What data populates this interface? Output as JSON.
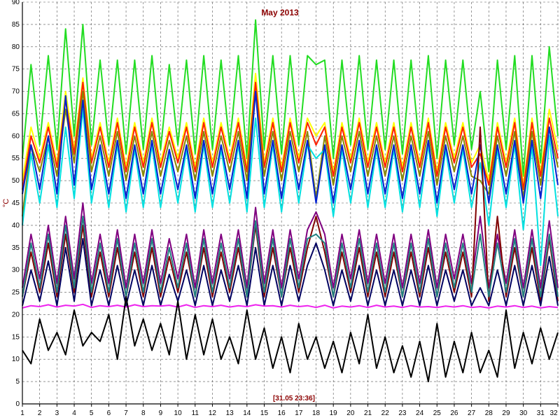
{
  "colors": {
    "background": "#ffffff",
    "grid": "#555555",
    "axis": "#000000",
    "title": "#8b0000"
  },
  "chart_data": {
    "type": "line",
    "title": "May 2013",
    "ylabel": "°C",
    "status": "[31.05 23:36]",
    "xlim": [
      1,
      32
    ],
    "ylim": [
      0,
      90
    ],
    "x_ticks": [
      "1",
      "2",
      "3",
      "4",
      "5",
      "6",
      "7",
      "8",
      "9",
      "10",
      "11",
      "12",
      "13",
      "14",
      "15",
      "16",
      "17",
      "18",
      "19",
      "20",
      "21",
      "22",
      "23",
      "24",
      "25",
      "26",
      "27",
      "28",
      "29",
      "30",
      "31",
      "32"
    ],
    "y_ticks": [
      "0",
      "5",
      "10",
      "15",
      "20",
      "25",
      "30",
      "35",
      "40",
      "45",
      "50",
      "55",
      "60",
      "65",
      "70",
      "75",
      "80",
      "85",
      "90"
    ],
    "grid": "dashed",
    "x": [
      1.0,
      1.5,
      2.0,
      2.5,
      3.0,
      3.5,
      4.0,
      4.5,
      5.0,
      5.5,
      6.0,
      6.5,
      7.0,
      7.5,
      8.0,
      8.5,
      9.0,
      9.5,
      10.0,
      10.5,
      11.0,
      11.5,
      12.0,
      12.5,
      13.0,
      13.5,
      14.0,
      14.5,
      15.0,
      15.5,
      16.0,
      16.5,
      17.0,
      17.5,
      18.0,
      18.5,
      19.0,
      19.5,
      20.0,
      20.5,
      21.0,
      21.5,
      22.0,
      22.5,
      23.0,
      23.5,
      24.0,
      24.5,
      25.0,
      25.5,
      26.0,
      26.5,
      27.0,
      27.5,
      28.0,
      28.5,
      29.0,
      29.5,
      30.0,
      30.5,
      31.0,
      31.5,
      32.0
    ],
    "series": [
      {
        "color": "#22dd22",
        "values": [
          55,
          76,
          58,
          78,
          57,
          84,
          60,
          85,
          58,
          77,
          58,
          77,
          56,
          77,
          57,
          78,
          57,
          76,
          58,
          77,
          56,
          78,
          57,
          77,
          58,
          78,
          55,
          86,
          57,
          78,
          56,
          78,
          58,
          78,
          76,
          77,
          55,
          77,
          58,
          78,
          57,
          77,
          57,
          77,
          56,
          77,
          57,
          78,
          55,
          77,
          58,
          77,
          57,
          70,
          52,
          77,
          57,
          78,
          51,
          78,
          54,
          80,
          60
        ]
      },
      {
        "color": "#ffff00",
        "values": [
          50,
          62,
          55,
          63,
          54,
          70,
          57,
          73,
          55,
          63,
          54,
          64,
          53,
          63,
          54,
          64,
          54,
          62,
          55,
          63,
          53,
          64,
          54,
          63,
          55,
          64,
          53,
          74,
          54,
          64,
          53,
          64,
          55,
          64,
          60,
          63,
          52,
          63,
          55,
          64,
          54,
          63,
          54,
          63,
          53,
          63,
          54,
          64,
          52,
          63,
          55,
          63,
          54,
          58,
          50,
          63,
          54,
          64,
          49,
          64,
          52,
          66,
          57
        ]
      },
      {
        "color": "#ff2000",
        "values": [
          48,
          60,
          54,
          62,
          53,
          68,
          56,
          72,
          54,
          62,
          53,
          63,
          52,
          62,
          53,
          63,
          53,
          61,
          54,
          62,
          52,
          63,
          53,
          62,
          54,
          63,
          52,
          72,
          53,
          63,
          52,
          63,
          54,
          63,
          58,
          62,
          51,
          62,
          54,
          63,
          53,
          62,
          53,
          62,
          52,
          62,
          53,
          63,
          51,
          62,
          54,
          62,
          53,
          56,
          49,
          62,
          53,
          63,
          48,
          63,
          51,
          64,
          55
        ]
      },
      {
        "color": "#888800",
        "values": [
          42,
          58,
          52,
          60,
          51,
          66,
          54,
          70,
          52,
          60,
          51,
          61,
          50,
          60,
          51,
          61,
          51,
          59,
          52,
          60,
          50,
          61,
          51,
          60,
          52,
          61,
          50,
          70,
          51,
          61,
          50,
          61,
          52,
          61,
          46,
          60,
          49,
          60,
          52,
          61,
          51,
          60,
          51,
          60,
          50,
          60,
          51,
          61,
          49,
          60,
          52,
          60,
          51,
          50,
          47,
          60,
          51,
          61,
          46,
          61,
          49,
          62,
          53
        ]
      },
      {
        "color": "#00e0e0",
        "values": [
          40,
          56,
          45,
          58,
          44,
          62,
          46,
          66,
          45,
          57,
          44,
          58,
          43,
          57,
          44,
          58,
          44,
          56,
          45,
          57,
          43,
          58,
          44,
          57,
          45,
          58,
          43,
          64,
          44,
          58,
          43,
          58,
          45,
          58,
          55,
          57,
          42,
          57,
          45,
          58,
          44,
          57,
          44,
          57,
          43,
          57,
          44,
          58,
          42,
          57,
          45,
          57,
          44,
          54,
          40,
          57,
          44,
          58,
          39,
          58,
          31,
          60,
          42
        ]
      },
      {
        "color": "#0020d0",
        "values": [
          47,
          58,
          48,
          60,
          47,
          69,
          49,
          68,
          48,
          58,
          47,
          59,
          46,
          58,
          47,
          59,
          47,
          57,
          48,
          58,
          46,
          59,
          47,
          58,
          48,
          59,
          46,
          70,
          47,
          59,
          46,
          59,
          48,
          59,
          45,
          58,
          45,
          58,
          48,
          59,
          47,
          58,
          47,
          58,
          46,
          58,
          47,
          59,
          45,
          58,
          48,
          58,
          47,
          58,
          45,
          58,
          47,
          59,
          45,
          59,
          46,
          62,
          49
        ]
      },
      {
        "color": "#800080",
        "values": [
          26,
          38,
          28,
          40,
          27,
          42,
          28,
          45,
          27,
          38,
          27,
          39,
          26,
          38,
          27,
          39,
          27,
          37,
          28,
          38,
          26,
          39,
          27,
          38,
          28,
          39,
          26,
          44,
          27,
          39,
          26,
          39,
          28,
          39,
          43,
          38,
          26,
          38,
          28,
          39,
          27,
          38,
          27,
          38,
          26,
          38,
          27,
          39,
          26,
          38,
          28,
          38,
          27,
          42,
          26,
          38,
          27,
          39,
          26,
          39,
          26,
          41,
          26
        ]
      },
      {
        "color": "#800000",
        "values": [
          24,
          34,
          25,
          36,
          24,
          38,
          25,
          40,
          24,
          34,
          24,
          35,
          24,
          34,
          24,
          35,
          24,
          33,
          25,
          34,
          24,
          35,
          24,
          34,
          25,
          35,
          24,
          40,
          24,
          35,
          24,
          35,
          25,
          35,
          42,
          34,
          24,
          34,
          25,
          35,
          24,
          34,
          24,
          34,
          24,
          34,
          24,
          35,
          24,
          34,
          25,
          34,
          24,
          62,
          23,
          42,
          24,
          35,
          24,
          35,
          23,
          37,
          23
        ]
      },
      {
        "color": "#208080",
        "values": [
          24,
          36,
          26,
          38,
          25,
          40,
          26,
          42,
          25,
          36,
          25,
          37,
          24,
          36,
          25,
          37,
          25,
          35,
          26,
          36,
          24,
          37,
          25,
          36,
          26,
          37,
          24,
          41,
          25,
          37,
          24,
          37,
          26,
          37,
          38,
          36,
          24,
          36,
          26,
          37,
          25,
          36,
          25,
          36,
          24,
          36,
          25,
          37,
          24,
          36,
          26,
          36,
          25,
          38,
          24,
          36,
          25,
          37,
          24,
          37,
          24,
          38,
          24
        ]
      },
      {
        "color": "#000060",
        "values": [
          22,
          30,
          23,
          32,
          22,
          35,
          23,
          37,
          22,
          30,
          22,
          31,
          22,
          30,
          22,
          31,
          22,
          29,
          23,
          30,
          22,
          31,
          22,
          30,
          23,
          31,
          22,
          35,
          22,
          31,
          22,
          31,
          23,
          31,
          36,
          30,
          22,
          30,
          23,
          31,
          22,
          30,
          22,
          30,
          22,
          30,
          22,
          31,
          22,
          30,
          23,
          30,
          22,
          26,
          22,
          30,
          22,
          31,
          22,
          31,
          22,
          33,
          22
        ]
      },
      {
        "color": "#ee22ee",
        "values": [
          21.5,
          22,
          21.8,
          22.2,
          21.7,
          22.1,
          21.9,
          22.3,
          21.6,
          22,
          21.8,
          22.1,
          21.7,
          22.2,
          21.8,
          22,
          21.9,
          22.1,
          21.7,
          22.2,
          21.6,
          22,
          21.8,
          22.1,
          21.7,
          22,
          21.8,
          22.2,
          21.9,
          22,
          21.7,
          22.1,
          21.8,
          22,
          21.6,
          22.1,
          21.5,
          21.9,
          21.7,
          22,
          21.6,
          22.1,
          21.7,
          21.9,
          21.6,
          22,
          21.7,
          21.8,
          21.6,
          21.9,
          21.7,
          22,
          21.6,
          21.8,
          21.5,
          21.9,
          21.7,
          22,
          21.6,
          21.9,
          21.5,
          21.8,
          21.6
        ]
      },
      {
        "color": "#000000",
        "values": [
          12,
          9,
          19,
          12,
          16,
          11,
          21,
          13,
          16,
          14,
          20,
          10,
          24,
          13,
          19,
          12,
          18,
          11,
          23,
          10,
          20,
          11,
          19,
          10,
          15,
          9,
          21,
          10,
          17,
          8,
          15,
          7,
          18,
          10,
          15,
          8,
          14,
          7,
          16,
          9,
          20,
          8,
          15,
          7,
          13,
          6,
          14,
          5,
          18,
          6,
          14,
          7,
          16,
          7,
          12,
          6,
          21,
          8,
          16,
          9,
          17,
          10,
          16
        ]
      }
    ]
  }
}
